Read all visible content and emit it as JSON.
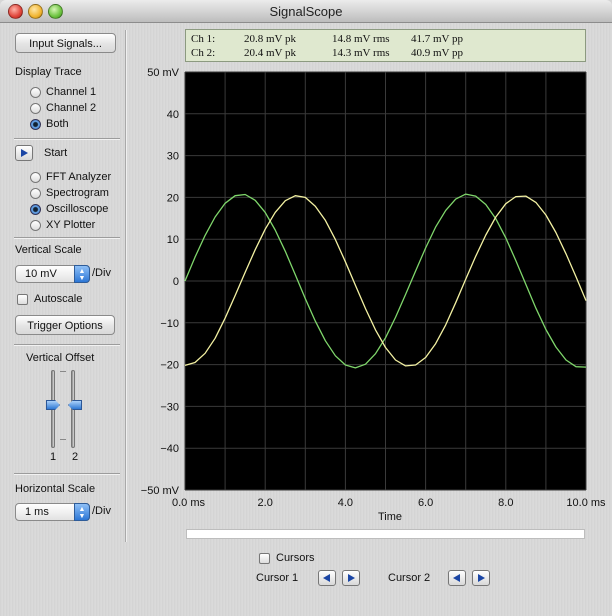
{
  "window": {
    "title": "SignalScope"
  },
  "left_panel": {
    "input_signals_button": "Input Signals...",
    "display_trace": {
      "heading": "Display Trace",
      "options": [
        "Channel 1",
        "Channel 2",
        "Both"
      ],
      "selected": "Both"
    },
    "start_label": "Start",
    "modes": {
      "options": [
        "FFT Analyzer",
        "Spectrogram",
        "Oscilloscope",
        "XY Plotter"
      ],
      "selected": "Oscilloscope"
    },
    "vertical_scale": {
      "heading": "Vertical Scale",
      "value": "10 mV",
      "unit": "/Div"
    },
    "autoscale_label": "Autoscale",
    "trigger_options_button": "Trigger Options",
    "vertical_offset": {
      "heading": "Vertical Offset",
      "channel1_label": "1",
      "channel2_label": "2"
    },
    "horizontal_scale": {
      "heading": "Horizontal Scale",
      "value": "1 ms",
      "unit": "/Div"
    }
  },
  "readout": {
    "rows": [
      {
        "channel": "Ch 1:",
        "peak": "20.8 mV pk",
        "rms": "14.8 mV rms",
        "pp": "41.7 mV pp"
      },
      {
        "channel": "Ch 2:",
        "peak": "20.4 mV pk",
        "rms": "14.3 mV rms",
        "pp": "40.9 mV pp"
      }
    ]
  },
  "bottom": {
    "cursors_label": "Cursors",
    "cursor1_label": "Cursor 1",
    "cursor2_label": "Cursor 2"
  },
  "colors": {
    "plot_background": "#000000",
    "grid": "#3a3a3a",
    "channel1": "#7fd66b",
    "channel2": "#f3f1a2"
  },
  "chart_data": {
    "type": "line",
    "title": "",
    "xlabel": "Time",
    "ylabel": "",
    "xlim": [
      0,
      10
    ],
    "ylim": [
      -50,
      50
    ],
    "grid": true,
    "x_ticks": [
      "0.0 ms",
      "2.0",
      "4.0",
      "6.0",
      "8.0",
      "10.0 ms"
    ],
    "y_ticks": [
      "50 mV",
      "40",
      "30",
      "20",
      "10",
      "0",
      "−10",
      "−20",
      "−30",
      "−40",
      "−50 mV"
    ],
    "series": [
      {
        "channel": 1,
        "x": [
          0,
          0.25,
          0.5,
          0.75,
          1.0,
          1.25,
          1.5,
          1.75,
          2.0,
          2.25,
          2.5,
          2.75,
          3.0,
          3.25,
          3.5,
          3.75,
          4.0,
          4.25,
          4.5,
          4.75,
          5.0,
          5.25,
          5.5,
          5.75,
          6.0,
          6.25,
          6.5,
          6.75,
          7.0,
          7.25,
          7.5,
          7.75,
          8.0,
          8.25,
          8.5,
          8.75,
          9.0,
          9.25,
          9.5,
          9.75,
          10.0
        ],
        "y": [
          0,
          5.7,
          10.9,
          15.3,
          18.6,
          20.4,
          20.7,
          19.3,
          16.4,
          12.2,
          7.1,
          1.5,
          -4.2,
          -9.6,
          -14.3,
          -17.9,
          -20.1,
          -20.8,
          -19.9,
          -17.4,
          -13.6,
          -8.7,
          -3.2,
          2.4,
          7.9,
          12.9,
          16.9,
          19.6,
          20.8,
          20.3,
          18.3,
          14.9,
          10.3,
          4.9,
          -0.8,
          -6.5,
          -11.6,
          -15.8,
          -18.9,
          -20.5,
          -20.6
        ]
      },
      {
        "channel": 2,
        "x": [
          0,
          0.25,
          0.5,
          0.75,
          1.0,
          1.25,
          1.5,
          1.75,
          2.0,
          2.25,
          2.5,
          2.75,
          3.0,
          3.25,
          3.5,
          3.75,
          4.0,
          4.25,
          4.5,
          4.75,
          5.0,
          5.25,
          5.5,
          5.75,
          6.0,
          6.25,
          6.5,
          6.75,
          7.0,
          7.25,
          7.5,
          7.75,
          8.0,
          8.25,
          8.5,
          8.75,
          9.0,
          9.25,
          9.5,
          9.75,
          10.0
        ],
        "y": [
          -20.2,
          -19.5,
          -17.3,
          -13.7,
          -8.9,
          -3.5,
          2.1,
          7.5,
          12.4,
          16.4,
          19.2,
          20.4,
          20.0,
          17.9,
          14.5,
          9.9,
          4.6,
          -1.0,
          -6.6,
          -11.7,
          -15.9,
          -18.9,
          -20.3,
          -20.1,
          -18.3,
          -15.0,
          -10.5,
          -5.2,
          0.4,
          5.9,
          11.0,
          15.3,
          18.5,
          20.2,
          20.3,
          18.8,
          15.8,
          11.6,
          6.5,
          1.0,
          -4.7
        ]
      }
    ]
  }
}
